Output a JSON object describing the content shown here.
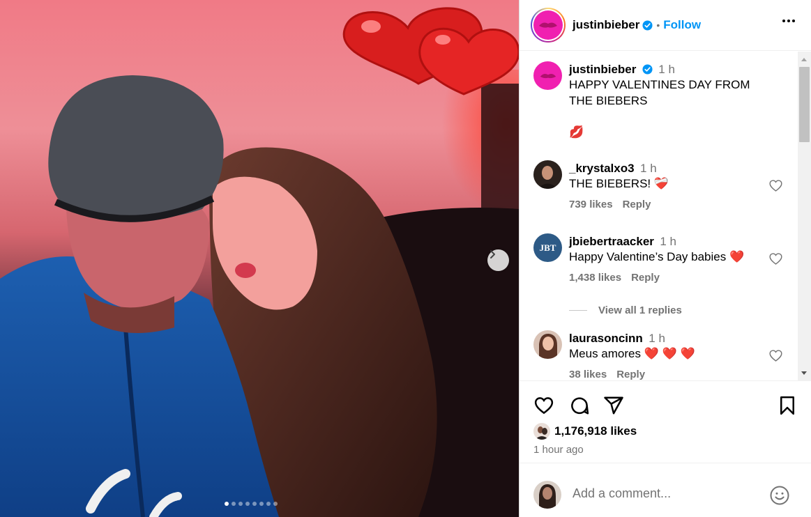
{
  "post": {
    "username": "justinbieber",
    "follow_label": "Follow",
    "separator": "•",
    "carousel": {
      "slides": 8,
      "active_index": 0
    }
  },
  "caption": {
    "username": "justinbieber",
    "time": "1 h",
    "text": "HAPPY VALENTINES DAY FROM THE BIEBERS",
    "emoji": "💋"
  },
  "comments": [
    {
      "username": "_krystalxo3",
      "time": "1 h",
      "text": "THE BIEBERS! ",
      "emoji": "❤️‍🩹",
      "likes": "739 likes",
      "reply": "Reply"
    },
    {
      "username": "jbiebertraacker",
      "time": "1 h",
      "text": "Happy Valentine’s Day babies ",
      "emoji": "❤️",
      "likes": "1,438 likes",
      "reply": "Reply",
      "view_replies": "View all 1 replies",
      "avatar_text": "JBT"
    },
    {
      "username": "laurasoncinn",
      "time": "1 h",
      "text": "Meus amores ",
      "emoji": "❤️ ❤️ ❤️",
      "likes": "38 likes",
      "reply": "Reply"
    }
  ],
  "engagement": {
    "likes": "1,176,918 likes",
    "time_ago": "1 hour ago"
  },
  "composer": {
    "placeholder": "Add a comment..."
  },
  "colors": {
    "follow_blue": "#0095f6",
    "secondary_text": "#737373",
    "heart_red": "#ed1c3a",
    "avatar_pink": "#f020b0"
  },
  "icons": [
    "verified-badge-icon",
    "more-options-icon",
    "heart-icon",
    "comment-icon",
    "share-icon",
    "bookmark-icon",
    "emoji-icon",
    "next-arrow-icon"
  ]
}
